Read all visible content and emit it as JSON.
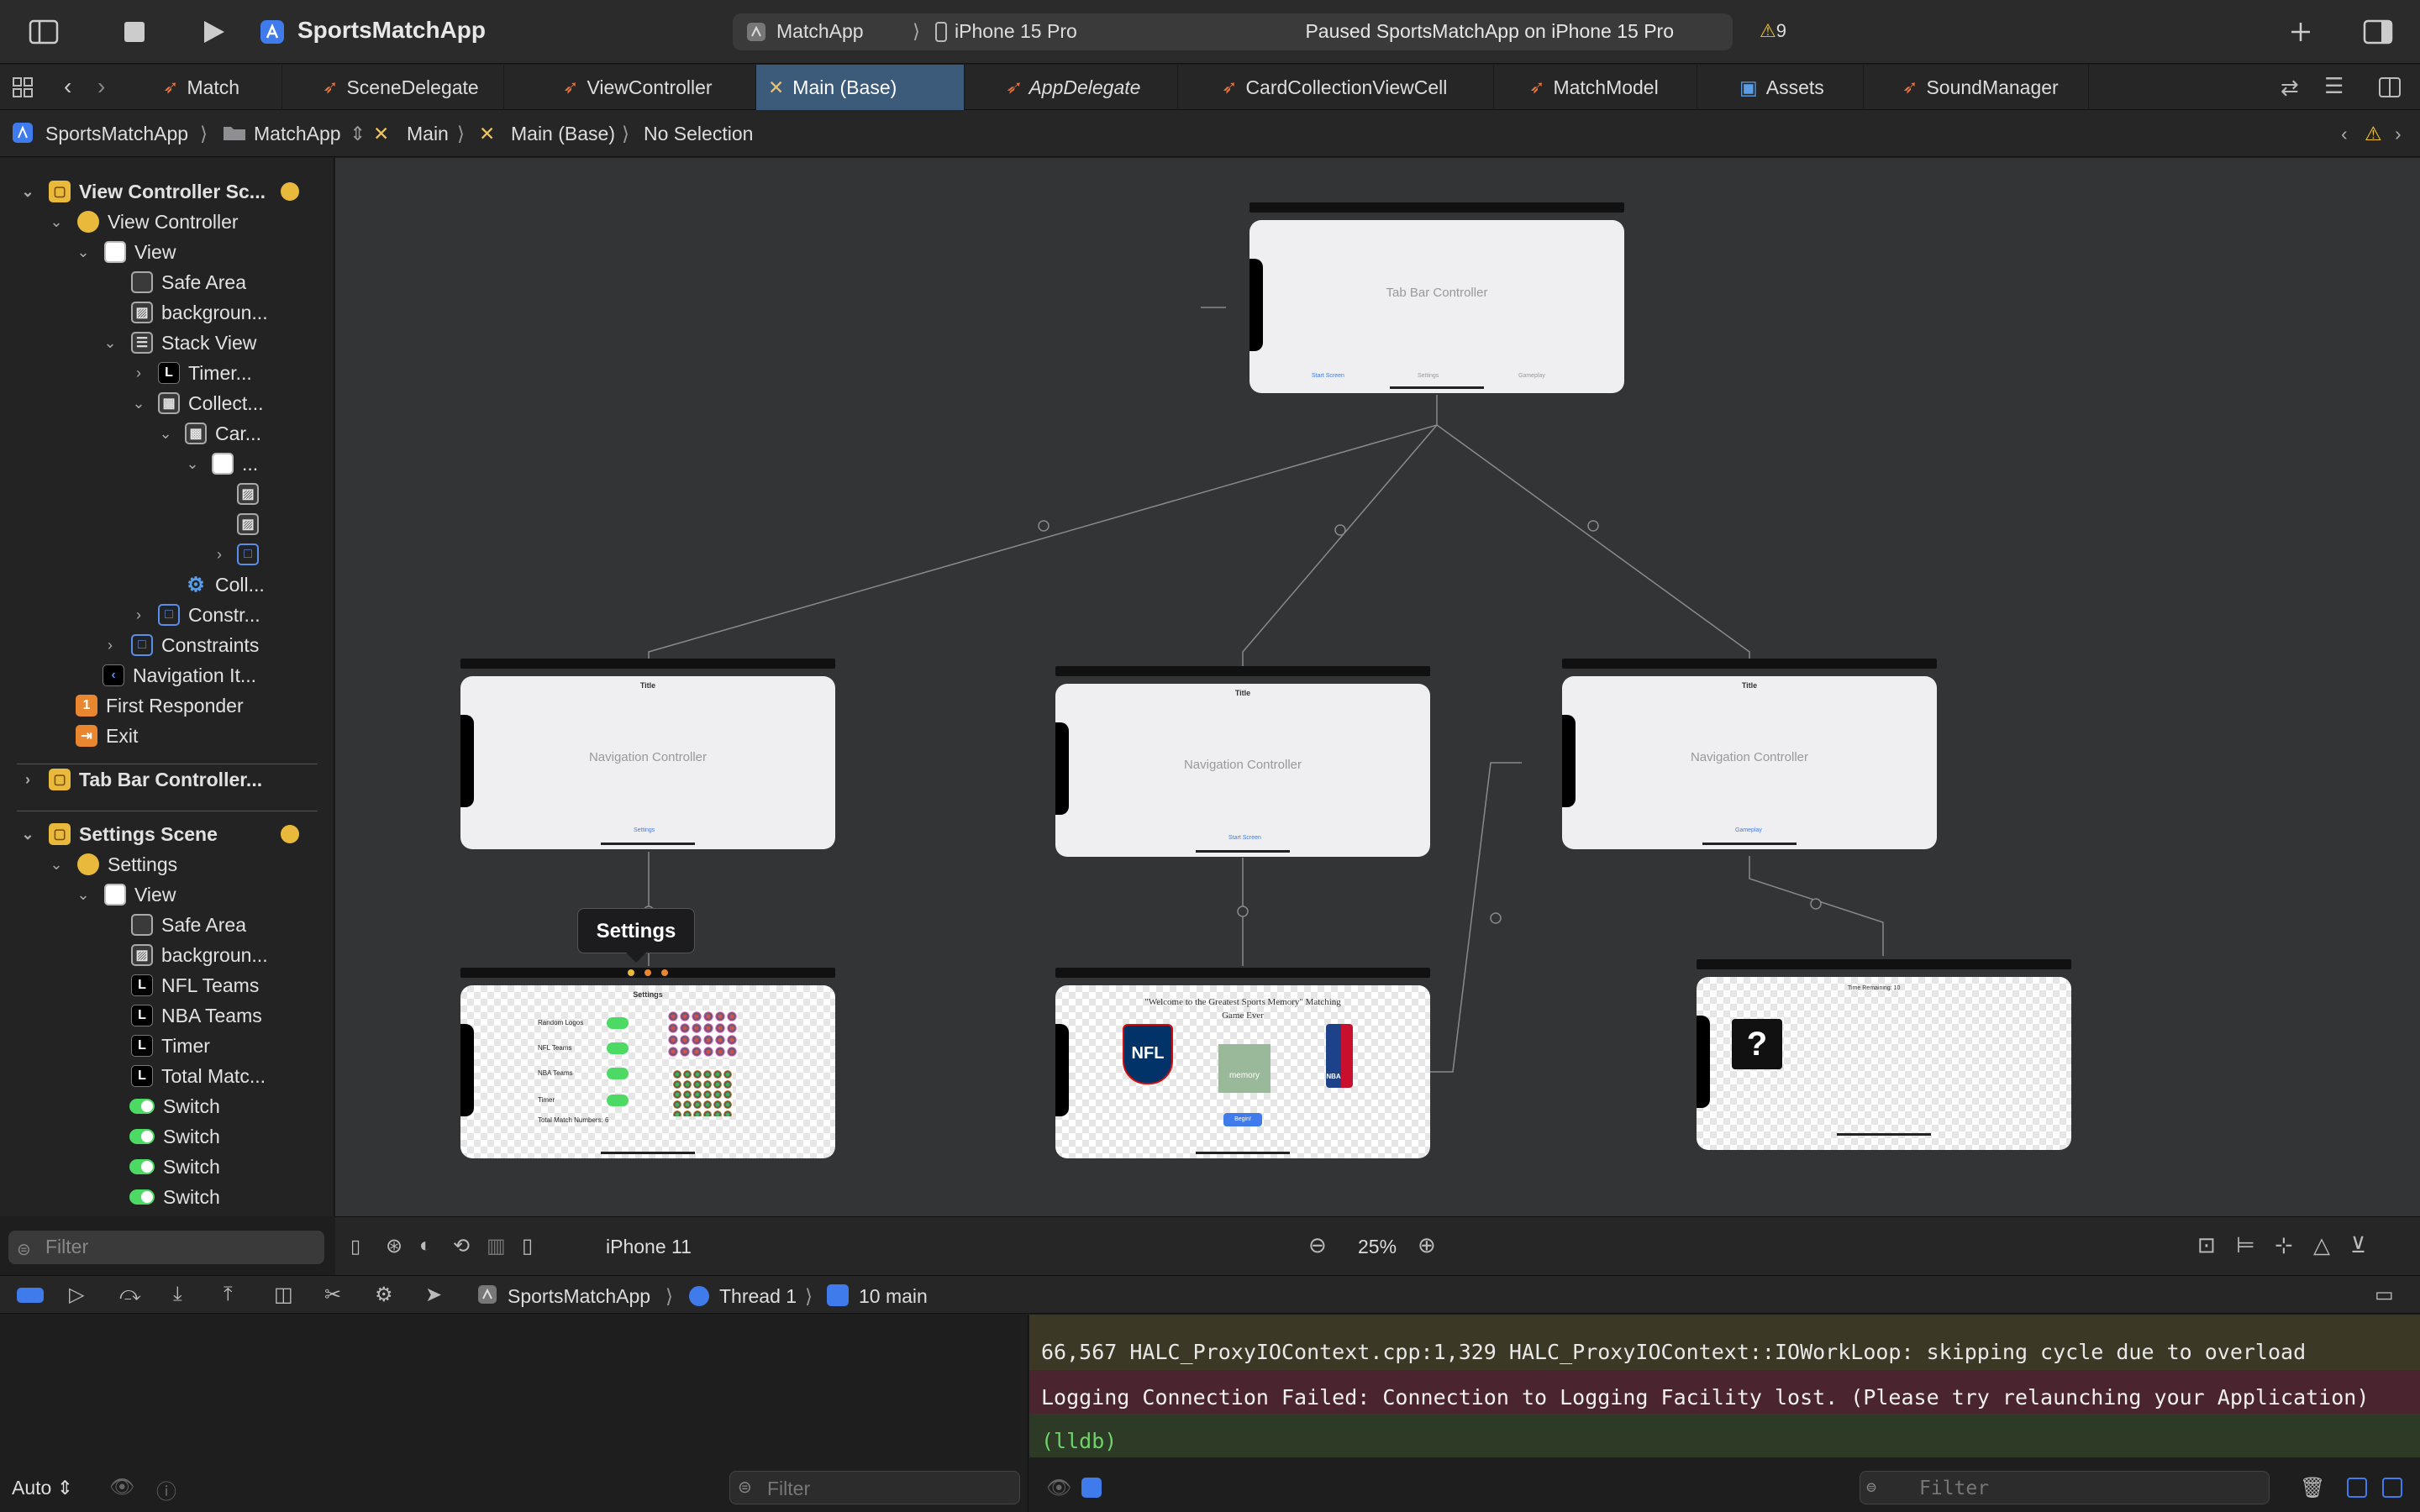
{
  "toolbar": {
    "app_title": "SportsMatchApp",
    "scheme": "MatchApp",
    "device": "iPhone 15 Pro",
    "status": "Paused SportsMatchApp on iPhone 15 Pro",
    "warnings": "9"
  },
  "tabs": [
    {
      "label": "Match"
    },
    {
      "label": "SceneDelegate"
    },
    {
      "label": "ViewController"
    },
    {
      "label": "Main (Base)"
    },
    {
      "label": "AppDelegate"
    },
    {
      "label": "CardCollectionViewCell"
    },
    {
      "label": "MatchModel"
    },
    {
      "label": "Assets"
    },
    {
      "label": "SoundManager"
    }
  ],
  "jumpbar": {
    "project": "SportsMatchApp",
    "folder": "MatchApp",
    "file": "Main",
    "variant": "Main (Base)",
    "selection": "No Selection"
  },
  "navigator": {
    "rows": [
      {
        "label": "View Controller Sc..."
      },
      {
        "label": "View Controller"
      },
      {
        "label": "View"
      },
      {
        "label": "Safe Area"
      },
      {
        "label": "backgroun..."
      },
      {
        "label": "Stack View"
      },
      {
        "label": "Timer..."
      },
      {
        "label": "Collect..."
      },
      {
        "label": "Car..."
      },
      {
        "label": "..."
      },
      {
        "label": "Coll..."
      },
      {
        "label": "Constr..."
      },
      {
        "label": "Constraints"
      },
      {
        "label": "Navigation It..."
      },
      {
        "label": "First Responder"
      },
      {
        "label": "Exit"
      },
      {
        "label": "Tab Bar Controller..."
      },
      {
        "label": "Settings Scene"
      },
      {
        "label": "Settings"
      },
      {
        "label": "View"
      },
      {
        "label": "Safe Area"
      },
      {
        "label": "backgroun..."
      },
      {
        "label": "NFL Teams"
      },
      {
        "label": "NBA Teams"
      },
      {
        "label": "Timer"
      },
      {
        "label": "Total Matc..."
      },
      {
        "label": "Switch"
      },
      {
        "label": "Switch"
      },
      {
        "label": "Switch"
      },
      {
        "label": "Switch"
      }
    ],
    "filter_placeholder": "Filter"
  },
  "canvas": {
    "tab_bar": {
      "label": "Tab Bar Controller",
      "items": [
        "Start Screen",
        "Settings",
        "Gameplay"
      ]
    },
    "nav_settings": {
      "title": "Title",
      "label": "Navigation Controller",
      "tab": "Settings"
    },
    "nav_start": {
      "title": "Title",
      "label": "Navigation Controller",
      "tab": "Start Screen"
    },
    "nav_gameplay": {
      "title": "Title",
      "label": "Navigation Controller",
      "tab": "Gameplay"
    },
    "tooltip": "Settings",
    "settings_vc": {
      "title": "Settings",
      "rows": [
        "Random Logos",
        "NFL Teams",
        "NBA Teams",
        "Timer",
        "Total Match Numbers:"
      ],
      "total_value": "6"
    },
    "start_vc": {
      "welcome": "\"Welcome to the Greatest Sports Memory\" Matching Game Ever",
      "nfl": "NFL",
      "memory": "memory",
      "nba": "NBA",
      "button": "Begin!"
    },
    "gameplay_vc": {
      "time": "Time Remaining: 10",
      "card": "?"
    },
    "bottom": {
      "device": "iPhone 11",
      "zoom": "25%"
    }
  },
  "debug": {
    "app": "SportsMatchApp",
    "thread": "Thread 1",
    "frame": "10 main"
  },
  "console": {
    "lines": [
      "66,567 HALC_ProxyIOContext.cpp:1,329 HALC_ProxyIOContext::IOWorkLoop: skipping cycle due to overload",
      "Logging Connection Failed: Connection to Logging Facility lost. (Please try relaunching your Application)",
      "(lldb)"
    ],
    "filter_placeholder": "Filter",
    "auto_label": "Auto"
  }
}
